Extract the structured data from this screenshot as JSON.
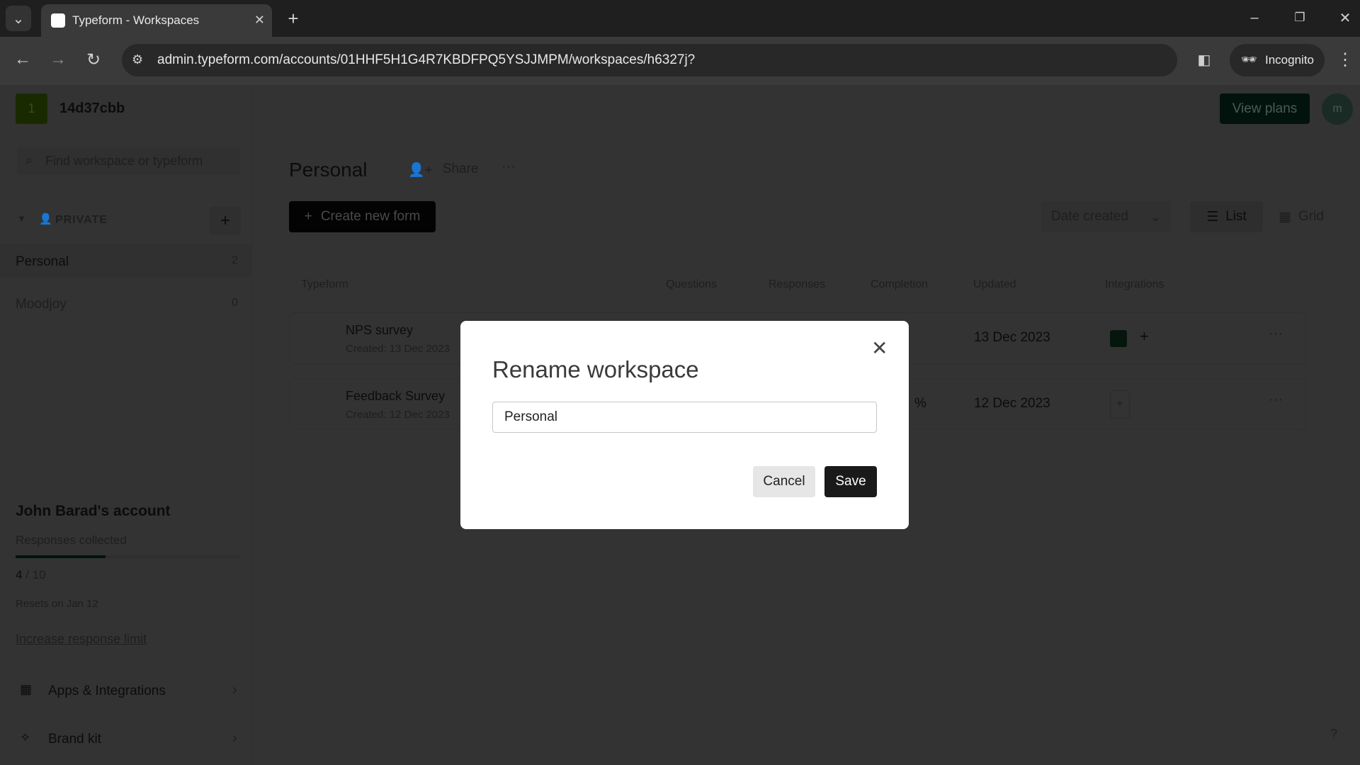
{
  "browser": {
    "tab_title": "Typeform - Workspaces",
    "url": "admin.typeform.com/accounts/01HHF5H1G4R7KBDFPQ5YSJJMPM/workspaces/h6327j?",
    "incognito_label": "Incognito"
  },
  "header": {
    "org_initial": "1",
    "org_name": "14d37cbb",
    "view_plans": "View plans",
    "avatar_initial": "m"
  },
  "sidebar": {
    "search_placeholder": "Find workspace or typeform",
    "section_label": "PRIVATE",
    "workspaces": [
      {
        "name": "Personal",
        "count": "2"
      },
      {
        "name": "Moodjoy",
        "count": "0"
      }
    ],
    "account_title": "John Barad's account",
    "responses_label": "Responses collected",
    "responses_used": "4",
    "responses_limit": "/ 10",
    "responses_fraction": 0.4,
    "resets": "Resets on Jan 12",
    "increase_link": "Increase response limit",
    "apps": "Apps & Integrations",
    "brand": "Brand kit"
  },
  "main": {
    "title": "Personal",
    "share": "Share",
    "create": "Create new form",
    "sort": "Date created",
    "view_list": "List",
    "view_grid": "Grid",
    "columns": [
      "Typeform",
      "Questions",
      "Responses",
      "Completion",
      "Updated",
      "Integrations"
    ],
    "rows": [
      {
        "name": "NPS survey",
        "created": "Created: 13 Dec 2023",
        "updated": "13 Dec 2023"
      },
      {
        "name": "Feedback Survey",
        "created": "Created: 12 Dec 2023",
        "completion": "%",
        "updated": "12 Dec 2023"
      }
    ]
  },
  "modal": {
    "title": "Rename workspace",
    "input_value": "Personal",
    "cancel": "Cancel",
    "save": "Save"
  },
  "help": "?",
  "colors": {
    "accent": "#0a4a3a",
    "excel": "#1d6f42"
  }
}
